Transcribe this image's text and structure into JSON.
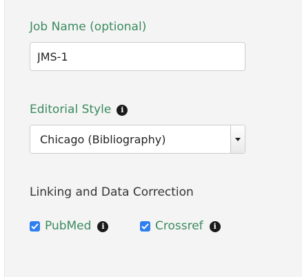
{
  "job_name": {
    "label": "Job Name (optional)",
    "value": "JMS-1"
  },
  "editorial_style": {
    "label": "Editorial Style",
    "info_icon": "info-circle-icon",
    "selected": "Chicago (Bibliography)"
  },
  "linking": {
    "title": "Linking and Data Correction",
    "options": [
      {
        "label": "PubMed",
        "checked": true,
        "icon": "info-circle-icon"
      },
      {
        "label": "Crossref",
        "checked": true,
        "icon": "info-circle-icon"
      }
    ]
  },
  "colors": {
    "label_green": "#3a8a5e",
    "checkbox_blue": "#2f7ff0",
    "panel_bg": "#f4f4f4"
  }
}
